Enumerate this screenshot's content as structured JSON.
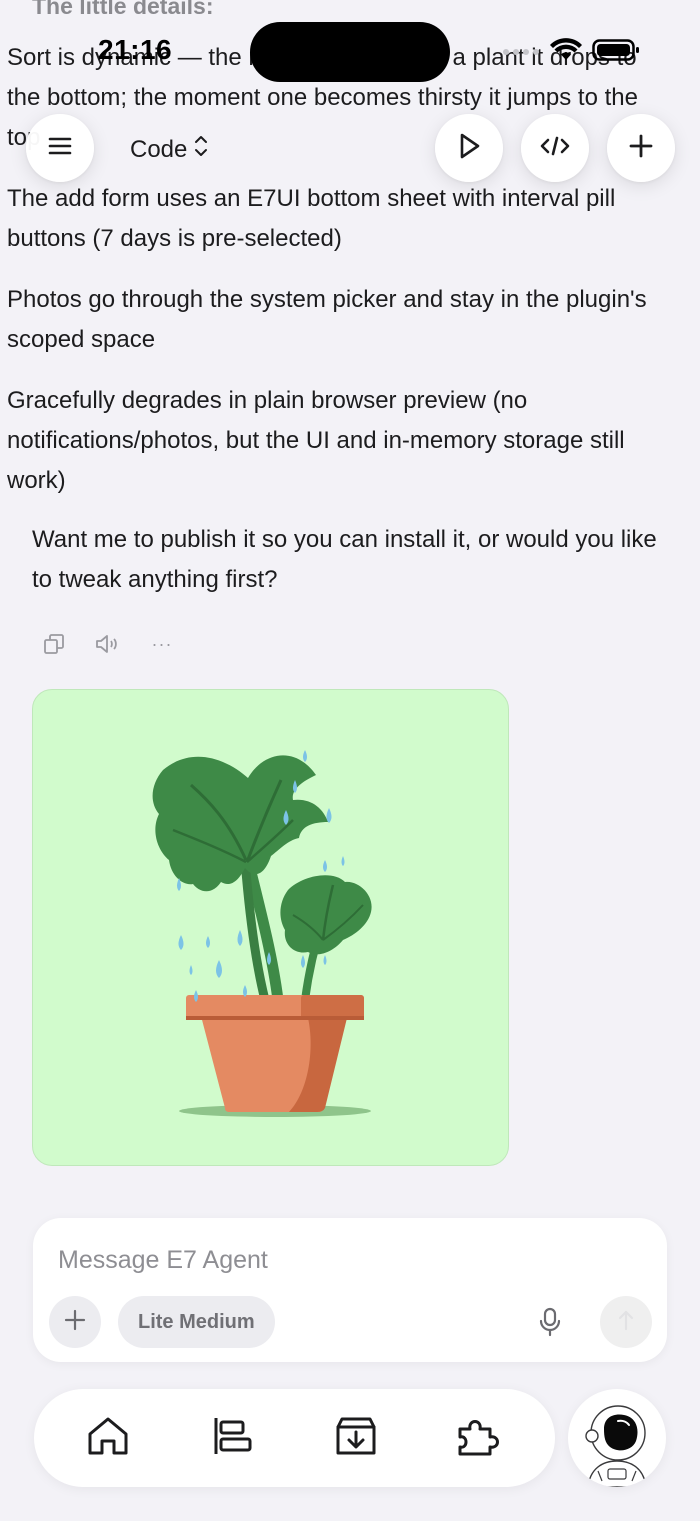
{
  "status_bar": {
    "time": "21:16"
  },
  "header": {
    "title": "Code"
  },
  "chat": {
    "section_title": "The little details:",
    "bullets": [
      "Sort is dynamic — the moment you water a plant it drops to the bottom; the moment one becomes thirsty it jumps to the top",
      "The add form uses an E7UI bottom sheet with interval pill buttons (7 days is pre-selected)",
      "Photos go through the system picker and stay in the plugin's scoped space",
      "Gracefully degrades in plain browser preview (no notifications/photos, but the UI and in-memory storage still work)"
    ],
    "question": "Want me to publish it so you can install it, or would you like to tweak anything first?",
    "more_label": "···"
  },
  "composer": {
    "placeholder": "Message E7 Agent",
    "model_label": "Lite Medium"
  },
  "colors": {
    "background": "#f3f2f7",
    "plant_card_bg": "#d1fbcc",
    "pot": "#e48a62",
    "leaf": "#3e8a47",
    "water": "#7cc3e6"
  }
}
